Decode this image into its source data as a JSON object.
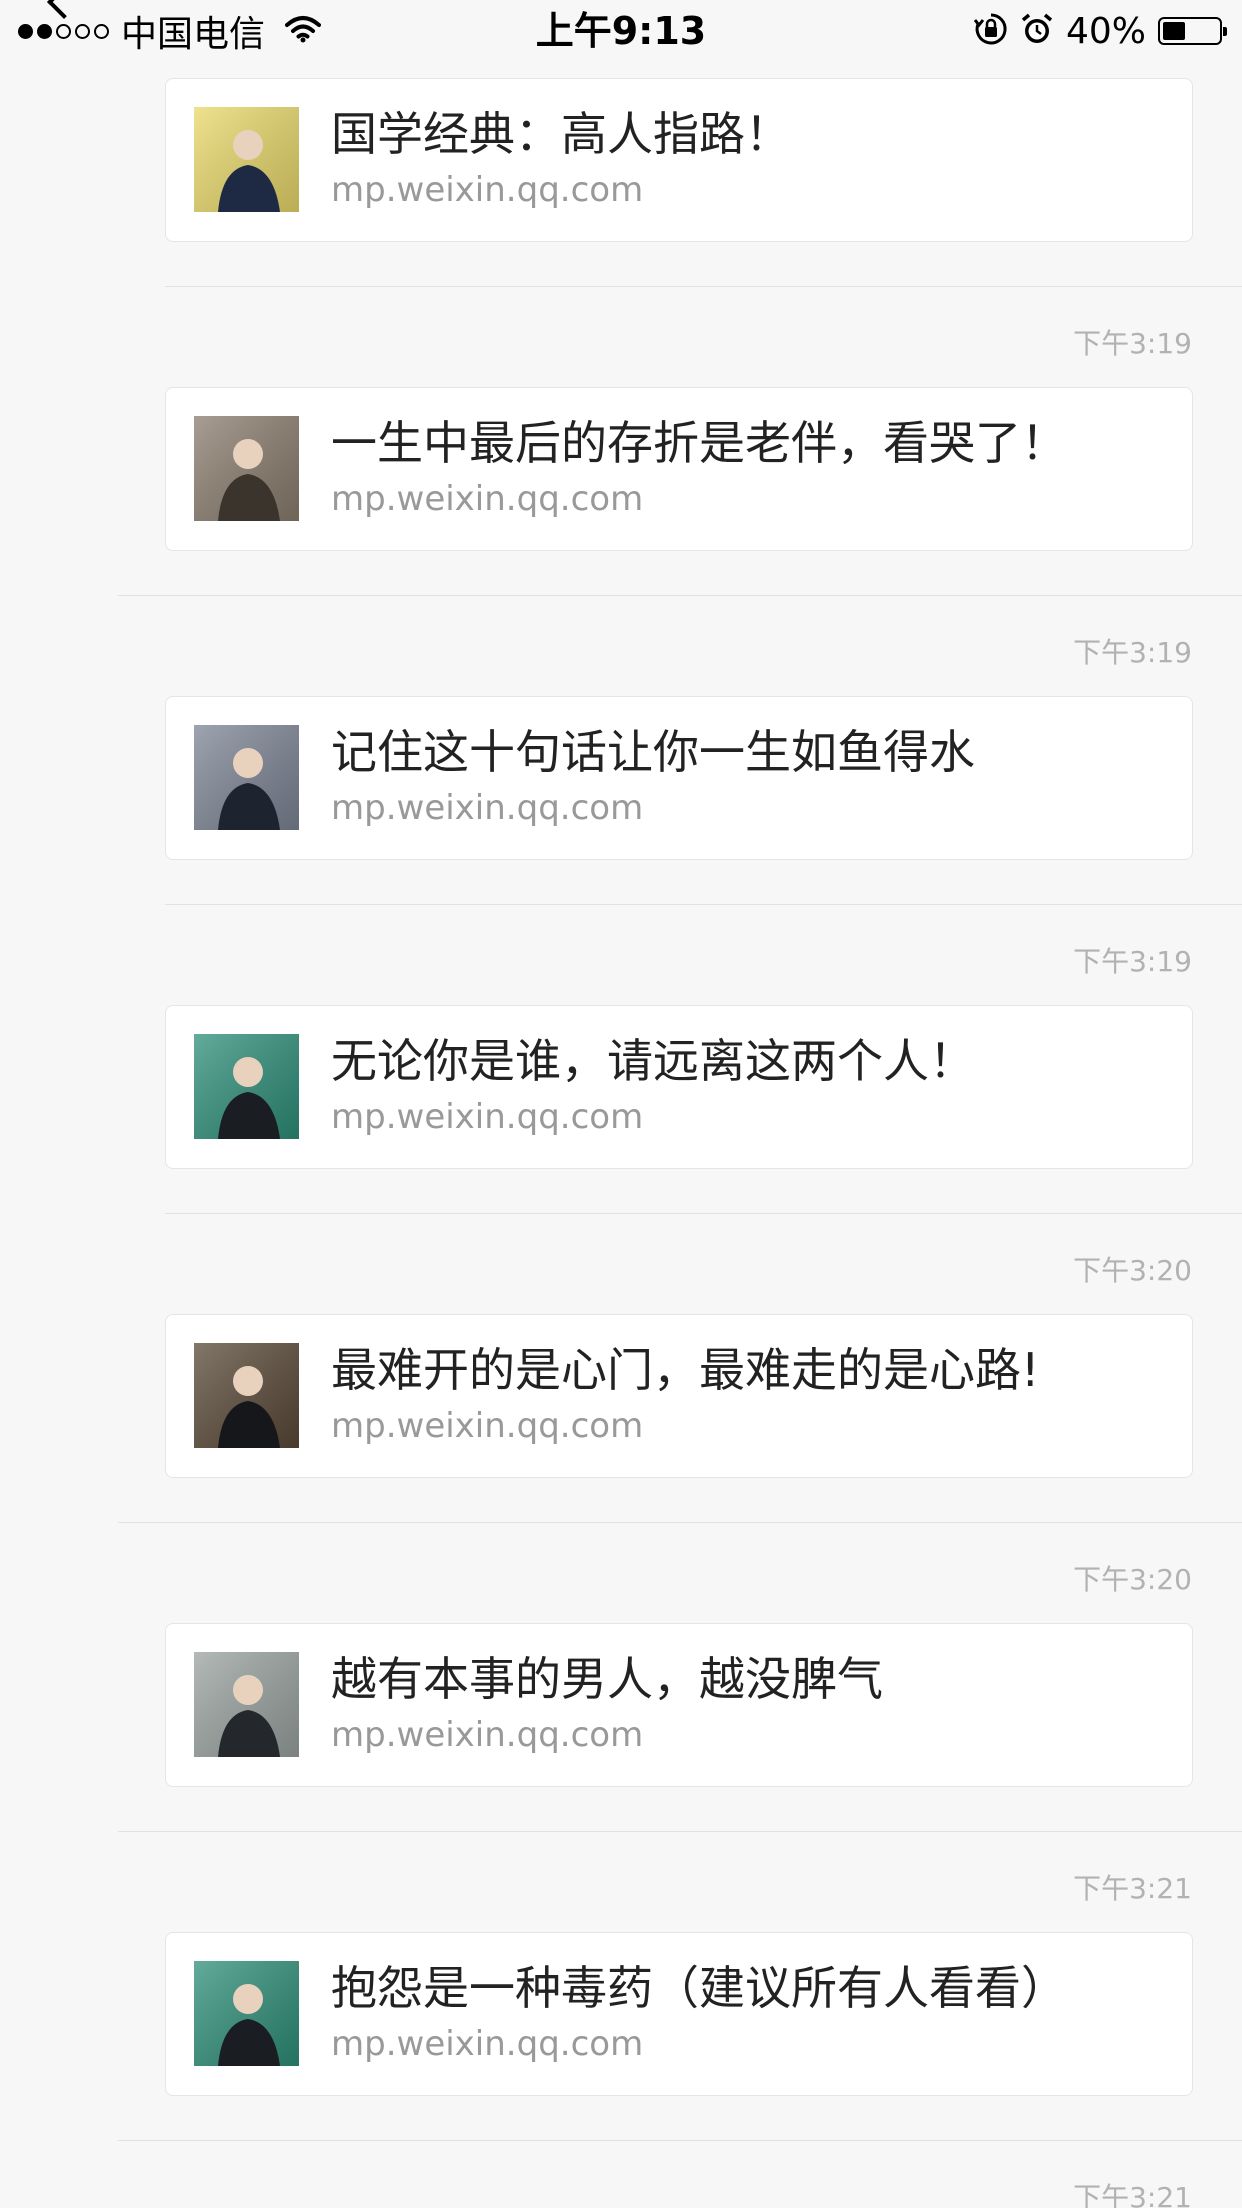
{
  "status_bar": {
    "carrier": "中国电信",
    "time": "上午9:13",
    "battery": "40%",
    "battery_level": 0.4,
    "signal_bars_filled": 2,
    "signal_bars_total": 5
  },
  "articles": [
    {
      "timestamp": "",
      "title": "国学经典：高人指路！",
      "source": "mp.weixin.qq.com",
      "thumb_colors": [
        "#e9d96b",
        "#1e2a44"
      ]
    },
    {
      "timestamp": "下午3:19",
      "title": "一生中最后的存折是老伴，看哭了！",
      "source": "mp.weixin.qq.com",
      "thumb_colors": [
        "#8a7d6e",
        "#3b342d"
      ]
    },
    {
      "timestamp": "下午3:19",
      "title": "记住这十句话让你一生如鱼得水",
      "source": "mp.weixin.qq.com",
      "thumb_colors": [
        "#7d8595",
        "#1e2330"
      ]
    },
    {
      "timestamp": "下午3:19",
      "title": "无论你是谁，请远离这两个人！",
      "source": "mp.weixin.qq.com",
      "thumb_colors": [
        "#2f8f7a",
        "#1a1d22"
      ]
    },
    {
      "timestamp": "下午3:20",
      "title": "最难开的是心门，最难走的是心路!",
      "source": "mp.weixin.qq.com",
      "thumb_colors": [
        "#5a4a38",
        "#15171b"
      ]
    },
    {
      "timestamp": "下午3:20",
      "title": "越有本事的男人，越没脾气",
      "source": "mp.weixin.qq.com",
      "thumb_colors": [
        "#9aa3a0",
        "#24272b"
      ]
    },
    {
      "timestamp": "下午3:21",
      "title": "抱怨是一种毒药（建议所有人看看）",
      "source": "mp.weixin.qq.com",
      "thumb_colors": [
        "#2f8f7a",
        "#1a1d22"
      ]
    },
    {
      "timestamp": "下午3:21",
      "title": "",
      "source": "",
      "thumb_colors": []
    }
  ],
  "colors": {
    "background": "#f7f7f7",
    "card": "#ffffff",
    "title_text": "#222222",
    "source_text": "#999999",
    "timestamp_text": "#b2b2b2"
  }
}
